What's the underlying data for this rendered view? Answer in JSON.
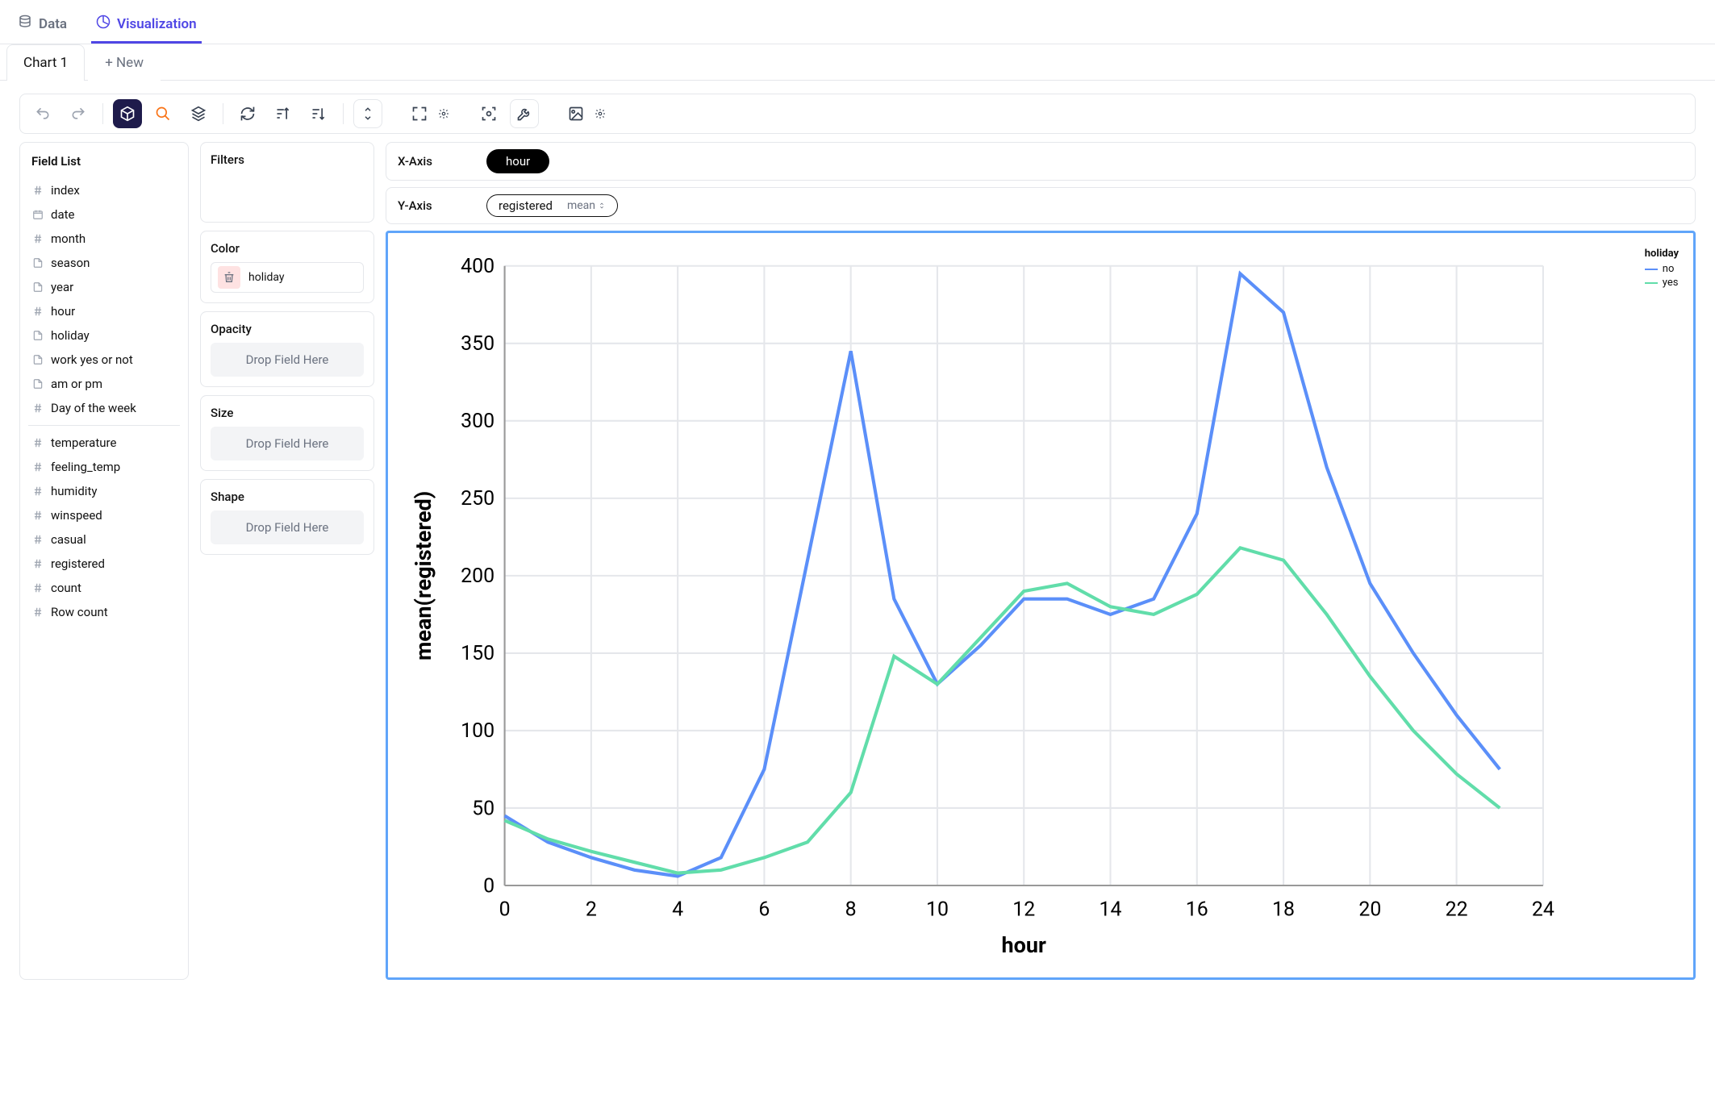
{
  "topTabs": {
    "data": "Data",
    "visualization": "Visualization"
  },
  "chartTabs": {
    "chart1": "Chart 1",
    "new": "+ New"
  },
  "fieldList": {
    "title": "Field List",
    "group1": [
      {
        "icon": "hash",
        "label": "index"
      },
      {
        "icon": "calendar",
        "label": "date"
      },
      {
        "icon": "hash",
        "label": "month"
      },
      {
        "icon": "doc",
        "label": "season"
      },
      {
        "icon": "doc",
        "label": "year"
      },
      {
        "icon": "hash",
        "label": "hour"
      },
      {
        "icon": "doc",
        "label": "holiday"
      },
      {
        "icon": "doc",
        "label": "work yes or not"
      },
      {
        "icon": "doc",
        "label": "am or pm"
      },
      {
        "icon": "hash",
        "label": "Day of the week"
      }
    ],
    "group2": [
      {
        "icon": "hash",
        "label": "temperature"
      },
      {
        "icon": "hash",
        "label": "feeling_temp"
      },
      {
        "icon": "hash",
        "label": "humidity"
      },
      {
        "icon": "hash",
        "label": "winspeed"
      },
      {
        "icon": "hash",
        "label": "casual"
      },
      {
        "icon": "hash",
        "label": "registered"
      },
      {
        "icon": "hash",
        "label": "count"
      },
      {
        "icon": "hash",
        "label": "Row count"
      }
    ]
  },
  "encodings": {
    "filters": "Filters",
    "color": "Color",
    "colorValue": "holiday",
    "opacity": "Opacity",
    "size": "Size",
    "shape": "Shape",
    "drop": "Drop Field Here"
  },
  "axes": {
    "xLabel": "X-Axis",
    "xField": "hour",
    "yLabel": "Y-Axis",
    "yField": "registered",
    "yAgg": "mean"
  },
  "chart_data": {
    "type": "line",
    "xlabel": "hour",
    "ylabel": "mean(registered)",
    "legend_title": "holiday",
    "xlim": [
      0,
      24
    ],
    "ylim": [
      0,
      400
    ],
    "xticks": [
      0,
      2,
      4,
      6,
      8,
      10,
      12,
      14,
      16,
      18,
      20,
      22,
      24
    ],
    "yticks": [
      0,
      50,
      100,
      150,
      200,
      250,
      300,
      350,
      400
    ],
    "x": [
      0,
      1,
      2,
      3,
      4,
      5,
      6,
      7,
      8,
      9,
      10,
      11,
      12,
      13,
      14,
      15,
      16,
      17,
      18,
      19,
      20,
      21,
      22,
      23
    ],
    "series": [
      {
        "name": "no",
        "color": "#5b8ff9",
        "values": [
          45,
          28,
          18,
          10,
          6,
          18,
          75,
          210,
          345,
          185,
          130,
          155,
          185,
          185,
          175,
          185,
          240,
          395,
          370,
          270,
          195,
          150,
          110,
          75
        ]
      },
      {
        "name": "yes",
        "color": "#61ddaa",
        "values": [
          42,
          30,
          22,
          15,
          8,
          10,
          18,
          28,
          60,
          148,
          130,
          160,
          190,
          195,
          180,
          175,
          188,
          218,
          210,
          175,
          135,
          100,
          72,
          50
        ]
      }
    ]
  }
}
